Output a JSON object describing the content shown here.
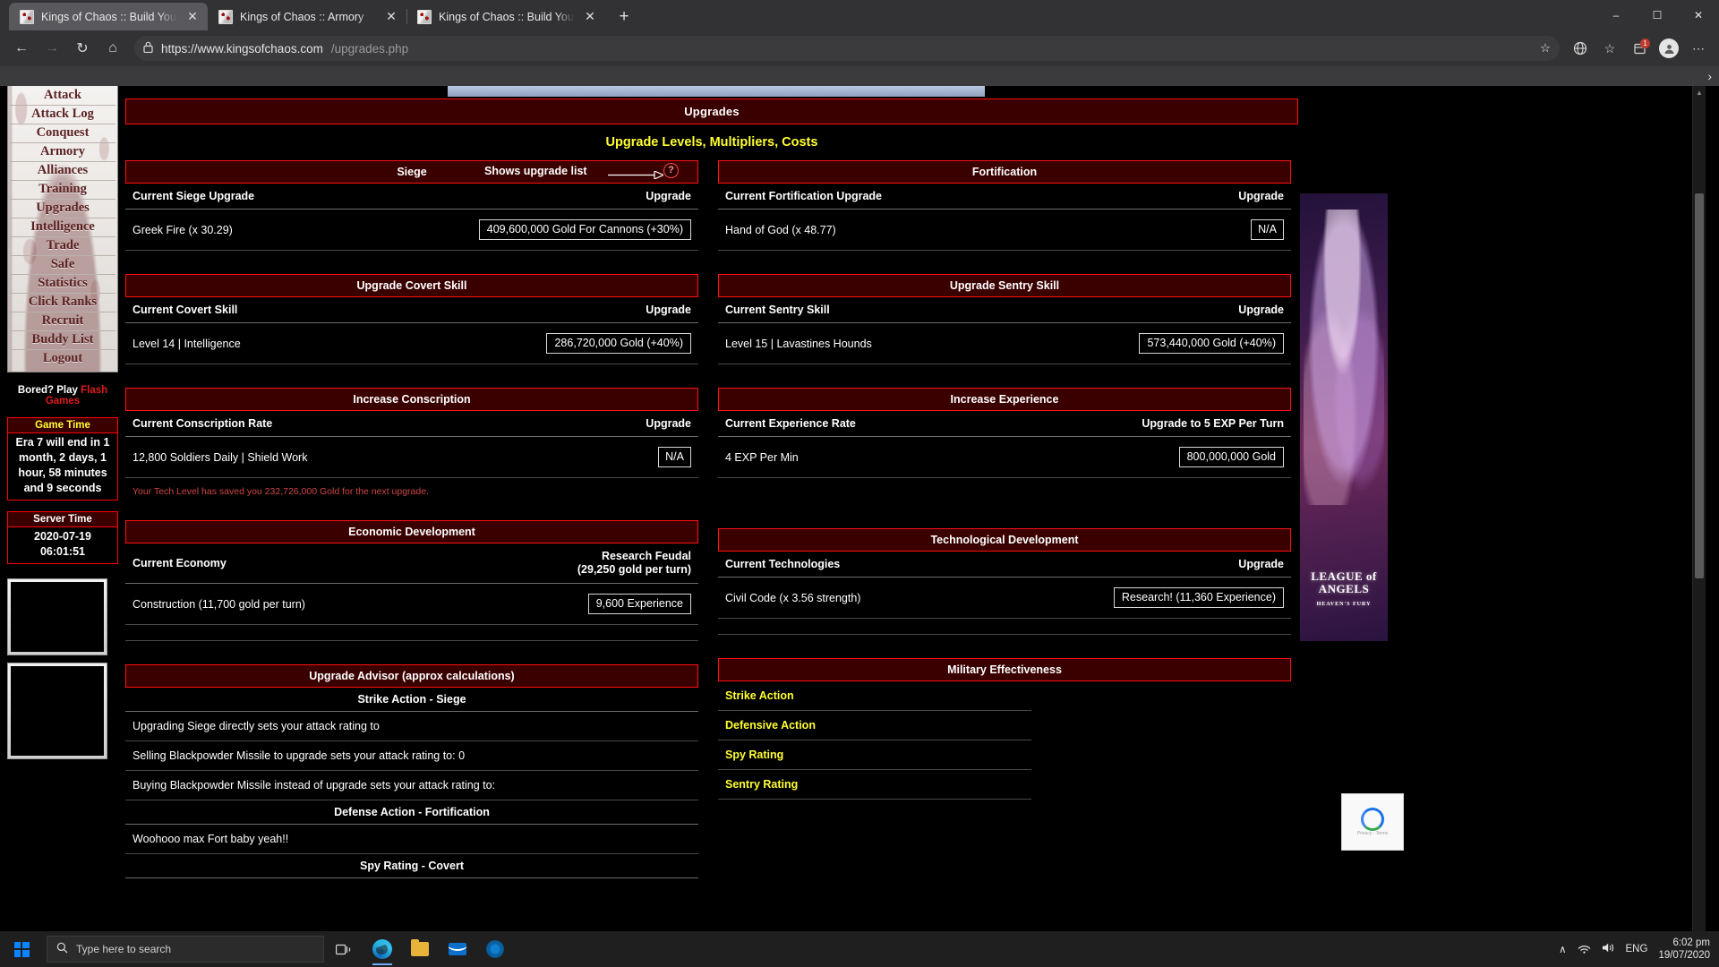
{
  "browser": {
    "tabs": [
      {
        "title": "Kings of Chaos :: Build Your Army",
        "active": true
      },
      {
        "title": "Kings of Chaos :: Armory",
        "active": false
      },
      {
        "title": "Kings of Chaos :: Build Your Army",
        "active": false
      }
    ],
    "new_tab_label": "+",
    "window_controls": {
      "minimize": "–",
      "maximize": "☐",
      "close": "✕"
    },
    "nav": {
      "back": "←",
      "forward": "→",
      "reload": "↻",
      "home": "⌂"
    },
    "address": {
      "lock": "ὑ2",
      "host": "https://www.kingsofchaos.com",
      "path": "/upgrades.php",
      "star": "☆"
    },
    "toolbar_icons": {
      "collections_badge": "1",
      "favorites": "☆",
      "collections": "▤",
      "profile": "●",
      "settings": "⋯"
    },
    "bookmark_overflow": "›"
  },
  "sidebar": {
    "menu": [
      {
        "label": "Attack"
      },
      {
        "label": "Attack Log"
      },
      {
        "label": "Conquest"
      },
      {
        "label": "Armory"
      },
      {
        "label": "Alliances"
      },
      {
        "label": "Training"
      },
      {
        "label": "Upgrades"
      },
      {
        "label": "Intelligence"
      },
      {
        "label": "Trade"
      },
      {
        "label": "Safe"
      },
      {
        "label": "Statistics"
      },
      {
        "label": "Click Ranks"
      },
      {
        "label": "Recruit"
      },
      {
        "label": "Buddy List"
      },
      {
        "label": "Logout"
      }
    ],
    "bored_prefix": "Bored? Play ",
    "bored_link": "Flash Games",
    "game_time": {
      "heading": "Game Time",
      "body": "Era 7 will end in 1 month, 2 days, 1 hour, 58 minutes and 9 seconds"
    },
    "server_time": {
      "heading": "Server Time",
      "date": "2020-07-19",
      "time": "06:01:51"
    }
  },
  "page": {
    "title": "Upgrades",
    "subtitle": "Upgrade Levels, Multipliers, Costs"
  },
  "panels": {
    "siege": {
      "heading": "Siege",
      "side_note": "Shows upgrade list",
      "help_icon": "?",
      "col_left": "Current Siege Upgrade",
      "col_right": "Upgrade",
      "item": "Greek Fire (x 30.29)",
      "action": "409,600,000 Gold For Cannons (+30%)"
    },
    "fortification": {
      "heading": "Fortification",
      "col_left": "Current Fortification Upgrade",
      "col_right": "Upgrade",
      "item": "Hand of God (x 48.77)",
      "action": "N/A"
    },
    "covert": {
      "heading": "Upgrade Covert Skill",
      "col_left": "Current Covert Skill",
      "col_right": "Upgrade",
      "item": "Level 14 | Intelligence",
      "action": "286,720,000 Gold (+40%)"
    },
    "sentry": {
      "heading": "Upgrade Sentry Skill",
      "col_left": "Current Sentry Skill",
      "col_right": "Upgrade",
      "item": "Level 15 | Lavastines Hounds",
      "action": "573,440,000 Gold (+40%)"
    },
    "conscription": {
      "heading": "Increase Conscription",
      "col_left": "Current Conscription Rate",
      "col_right": "Upgrade",
      "item": "12,800 Soldiers Daily | Shield Work",
      "action": "N/A",
      "note": "Your Tech Level has saved you 232,726,000 Gold for the next upgrade."
    },
    "experience": {
      "heading": "Increase Experience",
      "col_left": "Current Experience Rate",
      "col_right": "Upgrade to 5 EXP Per Turn",
      "item": "4 EXP Per Min",
      "action": "800,000,000 Gold"
    },
    "economic": {
      "heading": "Economic Development",
      "col_left": "Current Economy",
      "col_right_line1": "Research Feudal",
      "col_right_line2": "(29,250 gold per turn)",
      "item": "Construction (11,700 gold per turn)",
      "action": "9,600 Experience"
    },
    "technological": {
      "heading": "Technological Development",
      "col_left": "Current Technologies",
      "col_right": "Upgrade",
      "item": "Civil Code (x 3.56 strength)",
      "action": "Research! (11,360 Experience)"
    },
    "advisor": {
      "heading": "Upgrade Advisor (approx calculations)",
      "sections": [
        {
          "title": "Strike Action - Siege",
          "rows": [
            "Upgrading Siege directly sets your attack rating to",
            "Selling Blackpowder Missile to upgrade sets your attack rating to: 0",
            "Buying Blackpowder Missile instead of upgrade sets your attack rating to:"
          ]
        },
        {
          "title": "Defense Action - Fortification",
          "rows": [
            "Woohooo max Fort baby yeah!!"
          ]
        },
        {
          "title": "Spy Rating - Covert",
          "rows": []
        }
      ]
    },
    "military": {
      "heading": "Military Effectiveness",
      "rows": [
        "Strike Action",
        "Defensive Action",
        "Spy Rating",
        "Sentry Rating"
      ]
    }
  },
  "ads": {
    "rail_title": "LEAGUE of ANGELS",
    "rail_sub": "HEAVEN'S FURY"
  },
  "recaptcha": {
    "label": "reCAPTCHA",
    "privacy": "Privacy",
    "terms": "Terms",
    "separator": " - "
  },
  "taskbar": {
    "search_placeholder": "Type here to search",
    "search_icon": "ὐd",
    "apps": [
      {
        "name": "task-view"
      },
      {
        "name": "edge"
      },
      {
        "name": "file-explorer"
      },
      {
        "name": "mail"
      },
      {
        "name": "browser-alt"
      }
    ],
    "tray": {
      "chevron": "∧",
      "network": "὏6",
      "volume": "ὐa",
      "language": "ENG",
      "time": "6:02 pm",
      "date": "19/07/2020"
    }
  }
}
